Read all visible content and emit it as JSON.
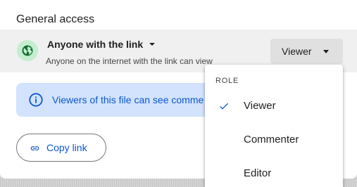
{
  "section_title": "General access",
  "access": {
    "title": "Anyone with the link",
    "subtitle": "Anyone on the internet with the link can view",
    "icon": "globe-icon",
    "role_button_label": "Viewer"
  },
  "info_banner": {
    "icon": "info-icon",
    "text": "Viewers of this file can see comme"
  },
  "copy_link": {
    "icon": "link-icon",
    "label": "Copy link"
  },
  "role_menu": {
    "header": "ROLE",
    "items": [
      {
        "label": "Viewer",
        "selected": true
      },
      {
        "label": "Commenter",
        "selected": false
      },
      {
        "label": "Editor",
        "selected": false
      }
    ]
  },
  "colors": {
    "accent": "#0b57d0",
    "banner_bg": "#d3e3fd",
    "globe_bg": "#c4eed0",
    "globe_fg": "#146c2e"
  }
}
